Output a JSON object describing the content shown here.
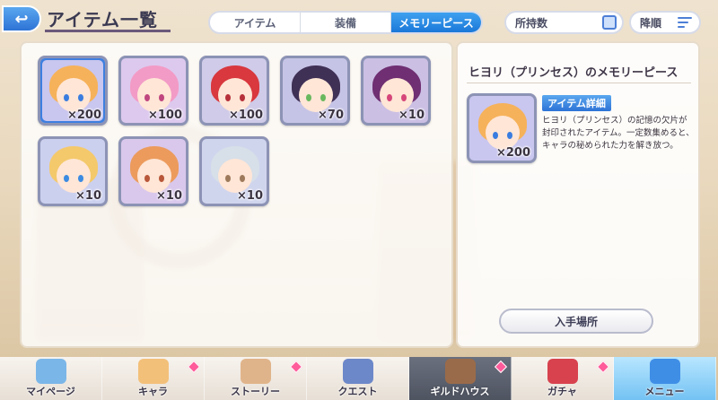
{
  "header": {
    "title": "アイテム一覧",
    "back_label": "↩"
  },
  "tabs": [
    {
      "label": "アイテム",
      "active": false
    },
    {
      "label": "装備",
      "active": false
    },
    {
      "label": "メモリーピース",
      "active": true
    }
  ],
  "sort": {
    "label": "所持数"
  },
  "order": {
    "label": "降順"
  },
  "items": [
    {
      "qty": "×200",
      "hair": "#f6b25a",
      "bg": "#c9c6ef",
      "eye": "#3a7de0",
      "selected": true
    },
    {
      "qty": "×100",
      "hair": "#f29bc6",
      "bg": "#ddc9ee",
      "eye": "#c0467f",
      "selected": false
    },
    {
      "qty": "×100",
      "hair": "#d8383e",
      "bg": "#cfcbe8",
      "eye": "#b6313a",
      "selected": false
    },
    {
      "qty": "×70",
      "hair": "#3f3056",
      "bg": "#c6c4e6",
      "eye": "#69b85e",
      "selected": false
    },
    {
      "qty": "×10",
      "hair": "#6f2f72",
      "bg": "#cbbfe4",
      "eye": "#d6467a",
      "selected": false
    },
    {
      "qty": "×10",
      "hair": "#f4c96b",
      "bg": "#ccd0ef",
      "eye": "#3b8be2",
      "selected": false
    },
    {
      "qty": "×10",
      "hair": "#ec9b5d",
      "bg": "#d9c8ec",
      "eye": "#b8573a",
      "selected": false
    },
    {
      "qty": "×10",
      "hair": "#d7dfe8",
      "bg": "#d0d5ee",
      "eye": "#9e7a5c",
      "selected": false
    }
  ],
  "detail": {
    "title": "ヒヨリ（プリンセス）のメモリーピース",
    "badge": "アイテム詳細",
    "description": "ヒヨリ（プリンセス）の記憶の欠片が封印されたアイテム。一定数集めると、キャラの秘められた力を解き放つ。",
    "qty": "×200",
    "source_button": "入手場所"
  },
  "nav": [
    {
      "label": "マイページ",
      "color": "#7bb6e8",
      "gem": false,
      "style": "normal"
    },
    {
      "label": "キャラ",
      "color": "#f3c07a",
      "gem": true,
      "style": "normal"
    },
    {
      "label": "ストーリー",
      "color": "#e0b48a",
      "gem": true,
      "style": "normal"
    },
    {
      "label": "クエスト",
      "color": "#6d88c9",
      "gem": false,
      "style": "normal"
    },
    {
      "label": "ギルドハウス",
      "color": "#9a6b4a",
      "gem": true,
      "style": "dark"
    },
    {
      "label": "ガチャ",
      "color": "#d7424e",
      "gem": true,
      "style": "normal"
    },
    {
      "label": "メニュー",
      "color": "#3f8ee6",
      "gem": false,
      "style": "active"
    }
  ]
}
